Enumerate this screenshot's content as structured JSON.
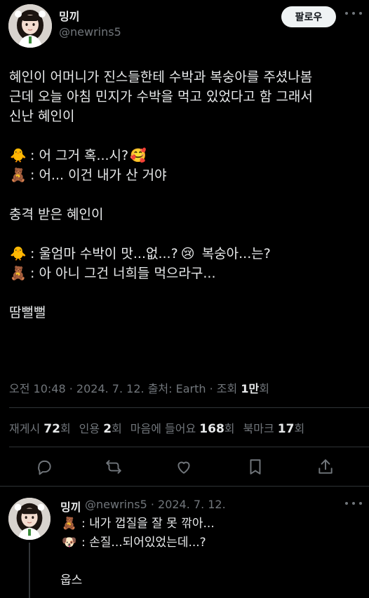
{
  "tweet": {
    "display_name": "밍끼",
    "handle": "@newrins5",
    "follow_label": "팔로우",
    "lines": [
      "혜인이 어머니가 진스들한테 수박과 복숭아를 주셨나봄",
      "근데 오늘 아침 민지가 수박을 먹고 있었다고 함 그래서",
      "신난 혜인이",
      "",
      ": 어 그거 혹...시?",
      ": 어... 이건 내가 산 거야",
      "",
      "충격 받은 혜인이",
      "",
      ": 울엄마 수박이 맛...없...?",
      "복숭아...는?",
      ": 아 아니 그건 너희들 먹으라구...",
      "",
      "땀뻘뻘"
    ],
    "emoji": {
      "chick": "🐥",
      "bear": "🧸",
      "smiling_hearts": "🥰",
      "crying": "😢",
      "dog": "🐶"
    },
    "meta": {
      "time": "오전 10:48",
      "date": "2024. 7. 12.",
      "source_label": "출처:",
      "source": "Earth",
      "views_label": "조회",
      "views_value": "1만",
      "views_suffix": "회"
    },
    "stats": [
      {
        "label": "재게시",
        "value": "72",
        "suffix": "회"
      },
      {
        "label": "인용",
        "value": "2",
        "suffix": "회"
      },
      {
        "label": "마음에 들어요",
        "value": "168",
        "suffix": "회"
      },
      {
        "label": "북마크",
        "value": "17",
        "suffix": "회"
      }
    ],
    "actions": [
      "reply-icon",
      "retweet-icon",
      "heart-icon",
      "bookmark-icon",
      "share-icon"
    ]
  },
  "reply": {
    "display_name": "밍끼",
    "handle_date": "@newrins5 · 2024. 7. 12.",
    "lines": [
      ": 내가 껍질을 잘 못 깎아...",
      ": 손질...되어있었는데...?",
      "",
      "웁스"
    ]
  },
  "colors": {
    "background": "#000000",
    "text": "#e7e9ea",
    "muted": "#71767b",
    "divider": "#2f3336",
    "follow_bg": "#eff3f4"
  }
}
